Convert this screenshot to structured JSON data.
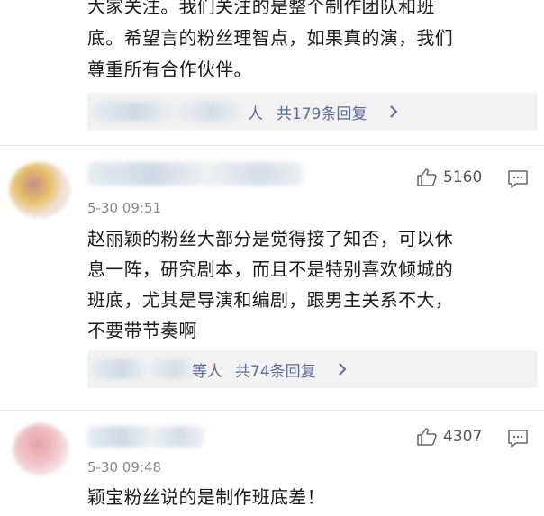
{
  "comment1": {
    "lines": [
      "大家关注。我们关注的是整个制作团队和班",
      "底。希望言的粉丝理智点，如果真的演，我们",
      "尊重所有合作伙伴。"
    ],
    "reply_suffix": "人",
    "reply_link": "共179条回复"
  },
  "comment2": {
    "time": "5-30 09:51",
    "likes": "5160",
    "lines": [
      "赵丽颖的粉丝大部分是觉得接了知否，可以休",
      "息一阵，研究剧本，而且不是特别喜欢倾城的",
      "班底，尤其是导演和编剧，跟男主关系不大，",
      "不要带节奏啊"
    ],
    "reply_suffix": "等人",
    "reply_link": "共74条回复"
  },
  "comment3": {
    "time": "5-30 09:48",
    "likes": "4307",
    "lines": [
      "颖宝粉丝说的是制作班底差！"
    ]
  },
  "icons": {
    "like": "thumbs-up-icon",
    "comment": "comment-bubble-icon",
    "chevron": "chevron-right-icon"
  },
  "colors": {
    "link": "#596b99",
    "reply_bg": "#f2f2f2"
  }
}
